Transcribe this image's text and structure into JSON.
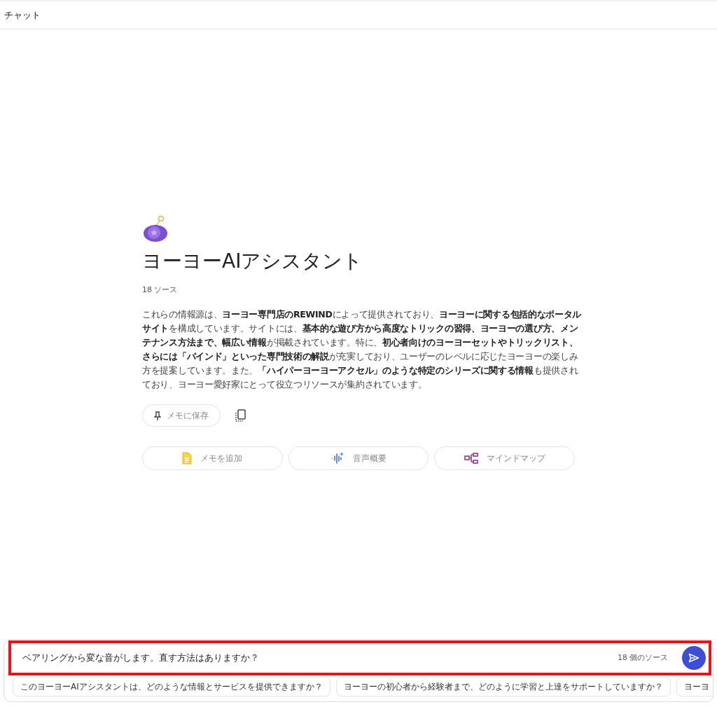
{
  "header": {
    "title": "チャット"
  },
  "notebook": {
    "title": "ヨーヨーAIアシスタント",
    "source_count": "18 ソース",
    "summary": "これらの情報源は、**ヨーヨー専門店のREWIND**によって提供されており、**ヨーヨーに関する包括的なポータルサイト**を構成しています。サイトには、**基本的な遊び方から高度なトリックの習得、ヨーヨーの選び方、メンテナンス方法まで、幅広い情報**が掲載されています。特に、**初心者向けのヨーヨーセットやトリックリスト、さらには「バインド」といった専門技術の解説**が充実しており、ユーザーのレベルに応じたヨーヨーの楽しみ方を提案しています。また、**「ハイパーヨーヨーアクセル」のような特定のシリーズに関する情報**も提供されており、ヨーヨー愛好家にとって役立つリソースが集約されています。",
    "save_button": "メモに保存",
    "actions": [
      {
        "kind": "note",
        "label": "メモを追加"
      },
      {
        "kind": "audio",
        "label": "音声概要"
      },
      {
        "kind": "mindmap",
        "label": "マインドマップ"
      }
    ]
  },
  "composer": {
    "value": "ベアリングから変な音がします。直す方法はありますか？",
    "source_count": "18 個のソース",
    "highlighted": true
  },
  "suggestions": [
    "このヨーヨーAIアシスタントは、どのような情報とサービスを提供できますか？",
    "ヨーヨーの初心者から経験者まで、どのように学習と上達をサポートしていますか？",
    "ヨーヨ"
  ]
}
